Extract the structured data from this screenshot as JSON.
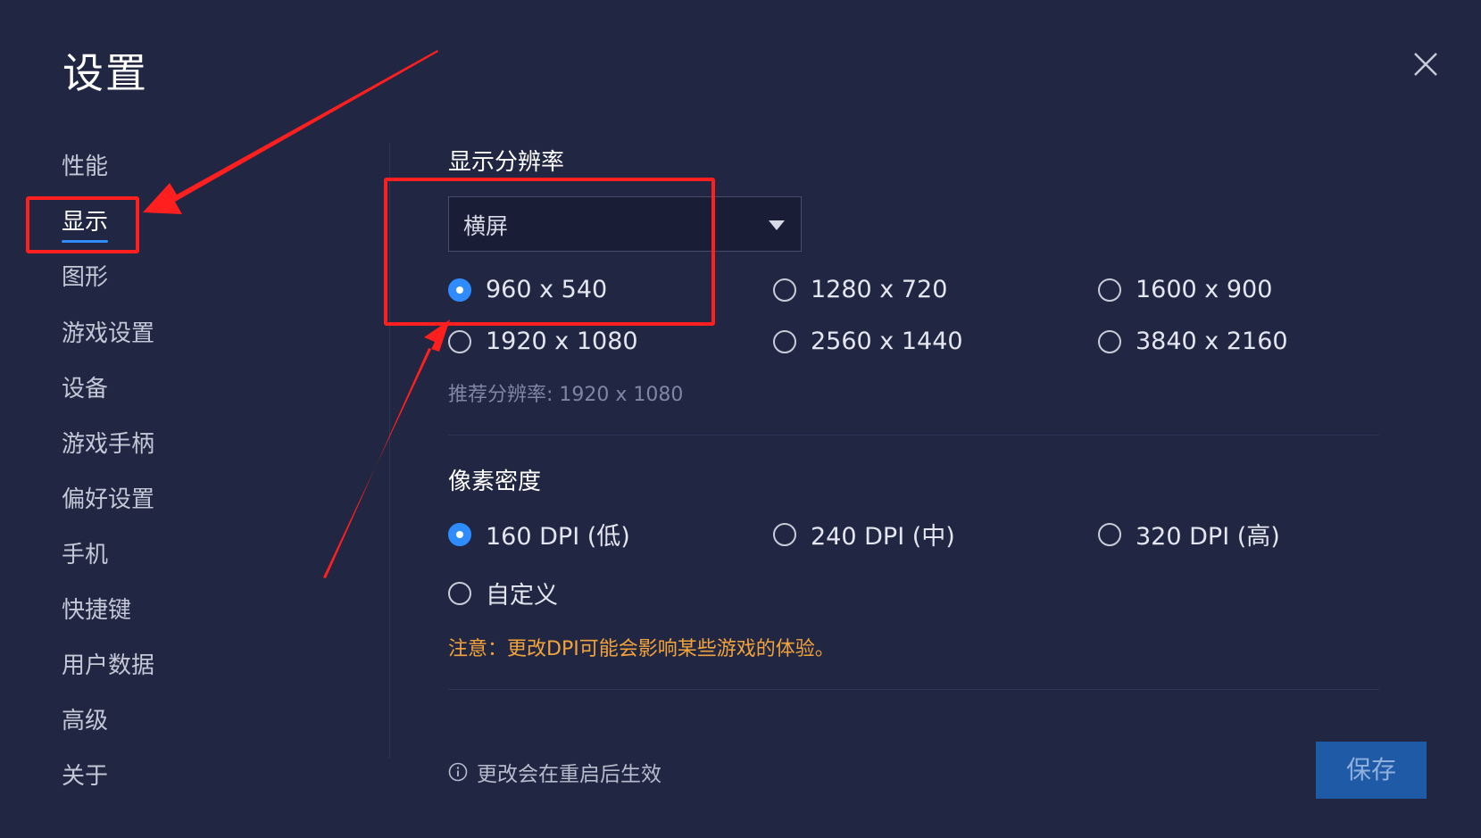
{
  "header": {
    "title": "设置"
  },
  "sidebar": {
    "items": [
      {
        "label": "性能",
        "active": false
      },
      {
        "label": "显示",
        "active": true
      },
      {
        "label": "图形",
        "active": false
      },
      {
        "label": "游戏设置",
        "active": false
      },
      {
        "label": "设备",
        "active": false
      },
      {
        "label": "游戏手柄",
        "active": false
      },
      {
        "label": "偏好设置",
        "active": false
      },
      {
        "label": "手机",
        "active": false
      },
      {
        "label": "快捷键",
        "active": false
      },
      {
        "label": "用户数据",
        "active": false
      },
      {
        "label": "高级",
        "active": false
      },
      {
        "label": "关于",
        "active": false
      }
    ]
  },
  "resolution": {
    "title": "显示分辨率",
    "orientation": "横屏",
    "options": [
      "960 x 540",
      "1280 x 720",
      "1600 x 900",
      "1920 x 1080",
      "2560 x 1440",
      "3840 x 2160"
    ],
    "selected": "960 x 540",
    "recommended": "推荐分辨率: 1920 x 1080"
  },
  "density": {
    "title": "像素密度",
    "options": [
      "160 DPI (低)",
      "240 DPI (中)",
      "320 DPI (高)",
      "自定义"
    ],
    "selected": "160 DPI (低)",
    "warning": "注意：更改DPI可能会影响某些游戏的体验。"
  },
  "footer": {
    "note": "更改会在重启后生效",
    "save_label": "保存"
  },
  "colors": {
    "background": "#212643",
    "accent": "#2f8cff",
    "save_button": "#1f5aa6",
    "warning": "#f2a33a",
    "annotation": "#ff1f1f"
  },
  "icons": {
    "close": "close-icon",
    "dropdown": "caret-down-icon",
    "info": "info-icon"
  }
}
